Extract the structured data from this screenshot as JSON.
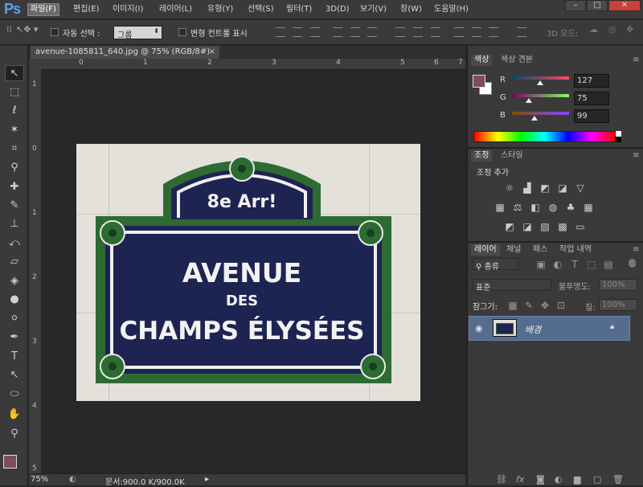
{
  "menubar": {
    "logo": "Ps",
    "items": [
      "파일(F)",
      "편집(E)",
      "이미지(I)",
      "레이어(L)",
      "유형(Y)",
      "선택(S)",
      "필터(T)",
      "3D(D)",
      "보기(V)",
      "창(W)",
      "도움말(H)"
    ],
    "window_buttons": [
      "–",
      "□",
      "✕"
    ]
  },
  "options": {
    "auto_select_label": "자동 선택 :",
    "auto_select_value": "그룹",
    "transform_controls_label": "변형 컨트롤 표시",
    "mode_3d_label": "3D 모드:"
  },
  "document": {
    "tab_title": "avenue-1085811_640.jpg @ 75% (RGB/8#)",
    "zoom": "75%",
    "doc_info": "문서:900.0 K/900.0K",
    "ruler_h": [
      "0",
      "1",
      "2",
      "3",
      "4",
      "5",
      "6",
      "7"
    ],
    "ruler_v": [
      "1",
      "0",
      "1",
      "2",
      "3",
      "4",
      "5"
    ]
  },
  "photo": {
    "sign_top": "8e Arr!",
    "sign_line1": "AVENUE",
    "sign_line2": "DES",
    "sign_line3": "CHAMPS ÉLYSÉES"
  },
  "color_panel": {
    "tabs": [
      "색상",
      "색상 견본"
    ],
    "channels": [
      {
        "label": "R",
        "value": "127",
        "fraction": 0.498
      },
      {
        "label": "G",
        "value": "75",
        "fraction": 0.294
      },
      {
        "label": "B",
        "value": "99",
        "fraction": 0.388
      }
    ],
    "foreground_color": "#7f4b63"
  },
  "adjust_panel": {
    "tabs": [
      "조정",
      "스타일"
    ],
    "title": "조정 추가"
  },
  "layers_panel": {
    "tabs": [
      "레이어",
      "채널",
      "패스",
      "작업 내역"
    ],
    "kind_label": "종류",
    "blend_mode": "표준",
    "opacity_label": "불투명도:",
    "opacity_value": "100%",
    "lock_label": "잠그기:",
    "fill_label": "칠:",
    "fill_value": "100%",
    "layer_name": "배경"
  }
}
